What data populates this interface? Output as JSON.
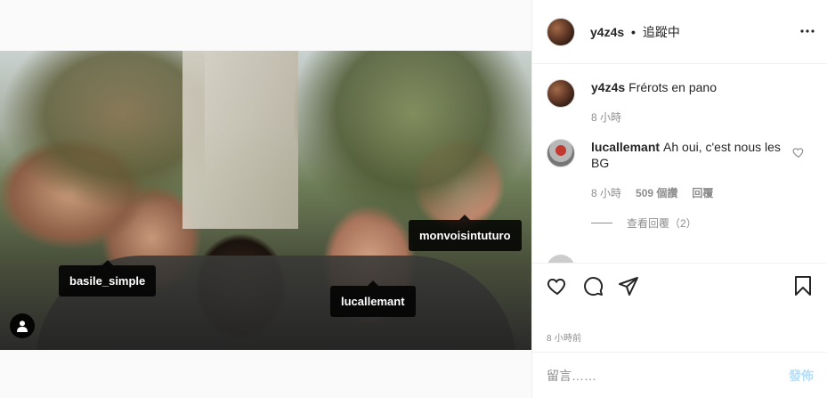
{
  "post": {
    "username": "y4z4s",
    "follow_separator": "•",
    "follow_status": "追蹤中",
    "caption": "Frérots en pano",
    "caption_time": "8 小時",
    "timestamp": "8 小時前"
  },
  "photo_tags": [
    {
      "label": "basile_simple"
    },
    {
      "label": "monvoisintuturo"
    },
    {
      "label": "lucallemant"
    }
  ],
  "comments": [
    {
      "user": "lucallemant",
      "text": "Ah oui, c'est nous les BG",
      "time": "8 小時",
      "likes": "509 個讚",
      "reply_label": "回覆",
      "view_replies": "查看回覆（2）"
    }
  ],
  "comment_box": {
    "placeholder": "留言……",
    "post_label": "發佈"
  },
  "icons": {
    "more": "more-horizontal-icon",
    "like": "heart-icon",
    "comment": "comment-icon",
    "share": "paper-plane-icon",
    "save": "bookmark-icon",
    "user_tags": "person-icon"
  },
  "colors": {
    "post_button": "#b2dffc",
    "meta_text": "#8e8e8e",
    "tag_bg": "#000000"
  }
}
